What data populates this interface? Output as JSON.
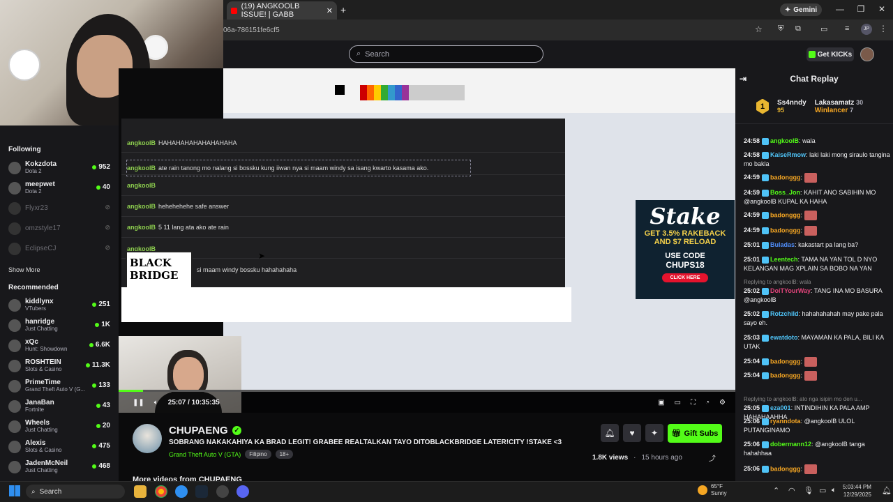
{
  "browser": {
    "tab_title": "(19) ANGKOOLB ISSUE! | GABB",
    "address": "06a-786151fe6cf5",
    "gemini_label": "Gemini",
    "profile_initials": "JP"
  },
  "header": {
    "search_placeholder": "Search",
    "get_kicks_label": "Get KICKs"
  },
  "sidebar": {
    "following_title": "Following",
    "following": [
      {
        "name": "Kokzdota",
        "game": "Dota 2",
        "viewers": "952",
        "online": true
      },
      {
        "name": "meepwet",
        "game": "Dota 2",
        "viewers": "40",
        "online": true
      },
      {
        "name": "Flyxr23",
        "game": "",
        "viewers": "",
        "online": false
      },
      {
        "name": "omzstyle17",
        "game": "",
        "viewers": "",
        "online": false
      },
      {
        "name": "EclipseCJ",
        "game": "",
        "viewers": "",
        "online": false
      }
    ],
    "show_more": "Show More",
    "recommended_title": "Recommended",
    "recommended": [
      {
        "name": "kiddlynx",
        "game": "VTubers",
        "viewers": "251"
      },
      {
        "name": "hanridge",
        "game": "Just Chatting",
        "viewers": "1K"
      },
      {
        "name": "xQc",
        "game": "Hunt: Showdown",
        "viewers": "6.6K"
      },
      {
        "name": "ROSHTEIN",
        "game": "Slots & Casino",
        "viewers": "11.3K"
      },
      {
        "name": "PrimeTime",
        "game": "Grand Theft Auto V (G...",
        "viewers": "133"
      },
      {
        "name": "JanaBan",
        "game": "Fortnite",
        "viewers": "43"
      },
      {
        "name": "Wheels",
        "game": "Just Chatting",
        "viewers": "20"
      },
      {
        "name": "Alexis",
        "game": "Slots & Casino",
        "viewers": "475"
      },
      {
        "name": "JadenMcNeil",
        "game": "Just Chatting",
        "viewers": "468"
      }
    ]
  },
  "video": {
    "chat_lines": [
      {
        "user": "angkoolB",
        "text": "HAHAHAHAHAHAHAHAHA"
      },
      {
        "user": "angkoolB",
        "text": "ate rain tanong mo nalang si bossku kung iiwan nya si maam windy sa isang kwarto kasama ako."
      },
      {
        "user": "angkoolB",
        "text": ""
      },
      {
        "user": "angkoolB",
        "text": "hehehehehe safe answer"
      },
      {
        "user": "angkoolB",
        "text": "5 11 lang ata ako ate rain"
      },
      {
        "user": "angkoolB",
        "text": ""
      },
      {
        "user": "",
        "text": "si maam windy bossku hahahahaha"
      }
    ],
    "watermark": "BLACK BRIDGE",
    "stake_ad": {
      "logo": "Stake",
      "line1": "GET 3.5% RAKEBACK",
      "line2": "AND $7 RELOAD",
      "line3": "USE CODE",
      "code": "CHUPS18",
      "button": "CLICK HERE"
    },
    "time": "25:07 / 10:35:35",
    "progress": 0.04
  },
  "stream": {
    "channel": "CHUPAENG",
    "title": "SOBRANG NAKAKAHIYA KA BRAD LEGIT! GRABEE REALTALKAN TAYO DITOBLACKBRIDGE LATER!CITY !STAKE <3",
    "category": "Grand Theft Auto V (GTA)",
    "tags": [
      "Filipino",
      "18+"
    ],
    "views": "1.8K views",
    "ago": "15 hours ago",
    "gift_subs": "Gift Subs",
    "more_videos": "More videos from CHUPAENG"
  },
  "chat": {
    "title": "Chat Replay",
    "leaderboard": [
      {
        "name": "Ss4nndy",
        "rank": "1",
        "score": "95"
      },
      {
        "name": "Lakasamatz",
        "score": "30"
      },
      {
        "name": "Winlancer",
        "score": "7"
      }
    ],
    "messages": [
      {
        "time": "24:58",
        "user": "angkoolB",
        "color": "#53fc18",
        "text": "wala",
        "emote": false,
        "reply": ""
      },
      {
        "time": "24:58",
        "user": "KaiseRmow",
        "color": "#4fc3f7",
        "text": "laki laki mong siraulo tangina mo bakla",
        "emote": false,
        "reply": ""
      },
      {
        "time": "24:59",
        "user": "badonggg",
        "color": "#f5a623",
        "text": "",
        "emote": true,
        "reply": ""
      },
      {
        "time": "24:59",
        "user": "Boss_Jon",
        "color": "#53fc18",
        "text": "KAHIT ANO SABIHIN MO @angkoolB KUPAL KA HAHA",
        "emote": false,
        "reply": ""
      },
      {
        "time": "24:59",
        "user": "badonggg",
        "color": "#f5a623",
        "text": "",
        "emote": true,
        "reply": ""
      },
      {
        "time": "24:59",
        "user": "badonggg",
        "color": "#f5a623",
        "text": "",
        "emote": true,
        "reply": ""
      },
      {
        "time": "25:01",
        "user": "Buladas",
        "color": "#4f8cf7",
        "text": "kakastart pa lang ba?",
        "emote": false,
        "reply": ""
      },
      {
        "time": "25:01",
        "user": "Leentech",
        "color": "#53fc18",
        "text": "TAMA NA YAN TOL D NYO KELANGAN MAG XPLAIN SA BOBO NA YAN",
        "emote": false,
        "reply": ""
      },
      {
        "time": "25:02",
        "user": "DoiTYourWay",
        "color": "#e0447a",
        "text": "TANG INA MO BASURA @angkoolB",
        "emote": false,
        "reply": "Replying to angkoolB: wala"
      },
      {
        "time": "25:02",
        "user": "Rotzchild",
        "color": "#4fc3f7",
        "text": "hahahahahah may pake pala sayo eh.",
        "emote": false,
        "reply": ""
      },
      {
        "time": "25:03",
        "user": "ewatdoto",
        "color": "#4fc3f7",
        "text": "MAYAMAN KA PALA, BILI KA UTAK",
        "emote": false,
        "reply": ""
      },
      {
        "time": "25:04",
        "user": "badonggg",
        "color": "#f5a623",
        "text": "",
        "emote": true,
        "reply": ""
      },
      {
        "time": "25:04",
        "user": "badonggg",
        "color": "#f5a623",
        "text": "",
        "emote": true,
        "reply": ""
      },
      {
        "time": "25:05",
        "user": "eza001",
        "color": "#4fc3f7",
        "text": "INTINDIHIN KA PALA AMP HAHAHAAHHA",
        "emote": false,
        "reply": "Replying to angkoolB: ato nga isipin mo den u..."
      },
      {
        "time": "25:06",
        "user": "ryanndota",
        "color": "#f5a623",
        "text": "@angkoolB ULOL PUTANGINAMO",
        "emote": false,
        "reply": ""
      },
      {
        "time": "25:06",
        "user": "dobermann12",
        "color": "#53fc18",
        "text": "@angkoolB tanga hahahhaa",
        "emote": false,
        "reply": ""
      },
      {
        "time": "25:06",
        "user": "badonggg",
        "color": "#f5a623",
        "text": "",
        "emote": true,
        "reply": ""
      }
    ]
  },
  "taskbar": {
    "search": "Search",
    "temp": "65°F",
    "weather": "Sunny",
    "time": "5:03:44 PM",
    "date": "12/29/2025"
  }
}
